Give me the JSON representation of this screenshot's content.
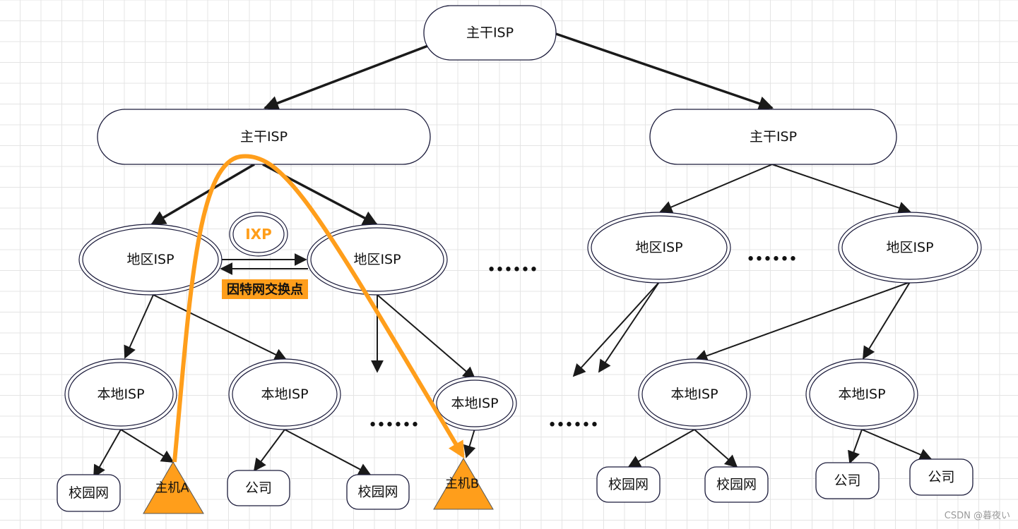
{
  "colors": {
    "accent": "#ff9e1b",
    "stroke": "#1a1a3a",
    "grid": "#e2e2e2",
    "label_bg": "#ff9e1b"
  },
  "nodes": {
    "top": "主干ISP",
    "backbone1": "主干ISP",
    "backbone2": "主干ISP",
    "regional1": "地区ISP",
    "regional2": "地区ISP",
    "regional3": "地区ISP",
    "regional4": "地区ISP",
    "ixp": "IXP",
    "ixp_label": "因特网交换点",
    "local1": "本地ISP",
    "local2": "本地ISP",
    "local3": "本地ISP",
    "local4": "本地ISP",
    "local5": "本地ISP",
    "campus1": "校园网",
    "company1": "公司",
    "campus2": "校园网",
    "campus3": "校园网",
    "campus4": "校园网",
    "company2": "公司",
    "company3": "公司",
    "hostA": "主机A",
    "hostB": "主机B"
  },
  "ellipsis": "••••••",
  "watermark": "CSDN @暮夜い"
}
